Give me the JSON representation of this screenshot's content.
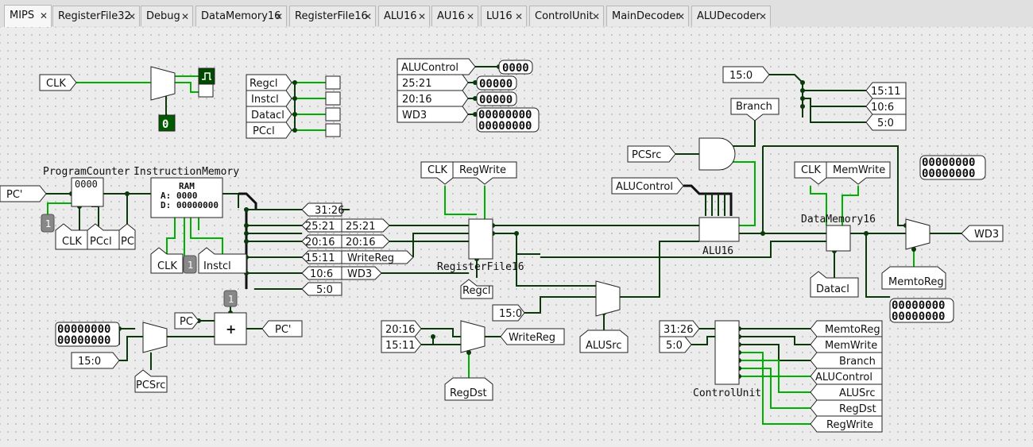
{
  "tabs": [
    {
      "label": "MIPS",
      "active": true
    },
    {
      "label": "RegisterFile32"
    },
    {
      "label": "Debug"
    },
    {
      "label": "DataMemory16"
    },
    {
      "label": "RegisterFile16"
    },
    {
      "label": "ALU16"
    },
    {
      "label": "AU16"
    },
    {
      "label": "LU16"
    },
    {
      "label": "ControlUnit"
    },
    {
      "label": "MainDecoder"
    },
    {
      "label": "ALUDecoder"
    }
  ],
  "close_glyph": "✕",
  "pins": {
    "clk": "CLK",
    "pc_in": "PC'",
    "pc": "PC",
    "pc_out": "PC'",
    "const_15_0": "15:0",
    "pcsrc": "PCSrc",
    "regcl": "Regcl",
    "instcl": "Instcl",
    "datacl": "Datacl",
    "pccl": "PCcl",
    "alucontrol_probe": "ALUControl",
    "p2521": "25:21",
    "p2016": "20:16",
    "wd3": "WD3",
    "pc_clk": "CLK",
    "pc_pccl": "PCcl",
    "pc_pc": "PC",
    "im_clk": "CLK",
    "im_instcl": "Instcl",
    "s3126": "31:26",
    "s2521": "25:21",
    "s2016": "20:16",
    "s1511": "15:11",
    "s106": "10:6",
    "s50": "5:0",
    "rf_clk": "CLK",
    "rf_regwrite": "RegWrite",
    "rf_regcl": "Regcl",
    "t2521": "25:21",
    "t2016": "20:16",
    "t_writereg": "WriteReg",
    "t_wd3": "WD3",
    "alu_pcsrc": "PCSrc",
    "alu_alucontrol": "ALUControl",
    "branch": "Branch",
    "dm_clk": "CLK",
    "dm_memwrite": "MemWrite",
    "dm_datacl": "Datacl",
    "memtoreg": "MemtoReg",
    "wd3_out": "WD3",
    "split_in": "15:0",
    "split_1511": "15:11",
    "split_106": "10:6",
    "split_50": "5:0",
    "wd_2016": "20:16",
    "wd_1511": "15:11",
    "writereg": "WriteReg",
    "regdst": "RegDst",
    "alusrc_const": "15:0",
    "alusrc": "ALUSrc",
    "cu_3126": "31:26",
    "cu_50": "5:0",
    "cu_memtoreg": "MemtoReg",
    "cu_memwrite": "MemWrite",
    "cu_branch": "Branch",
    "cu_alucontrol": "ALUControl",
    "cu_alusrc": "ALUSrc",
    "cu_regdst": "RegDst",
    "cu_regwrite": "RegWrite"
  },
  "labels": {
    "programcounter": "ProgramCounter",
    "instructionmemory": "InstructionMemory",
    "registerfile": "RegisterFile16",
    "alu": "ALU16",
    "datamemory": "DataMemory16",
    "controlunit": "ControlUnit"
  },
  "values": {
    "clock_counter": "0",
    "pc_value": "0000",
    "probe_alucontrol": "0000",
    "probe_2521": "00000",
    "probe_2016": "00000",
    "probe_wd3_line1": "00000000",
    "probe_wd3_line2": "00000000",
    "probe_right_line1": "00000000",
    "probe_right_line2": "00000000",
    "probe_dm_line1": "00000000",
    "probe_dm_line2": "00000000",
    "probe_left_line1": "00000000",
    "probe_left_line2": "00000000",
    "const_1_a": "1",
    "const_1_b": "1",
    "const_1_c": "1"
  },
  "ram": {
    "title": "RAM",
    "addr_label": "A:",
    "addr": "0000",
    "data_label": "D:",
    "data": "00000000"
  },
  "adder_symbol": "+",
  "colors": {
    "wire_high": "#00b000",
    "wire_low": "#0a3a0a",
    "bus": "#111111",
    "canvas": "#ececec",
    "led": "#005a00"
  }
}
